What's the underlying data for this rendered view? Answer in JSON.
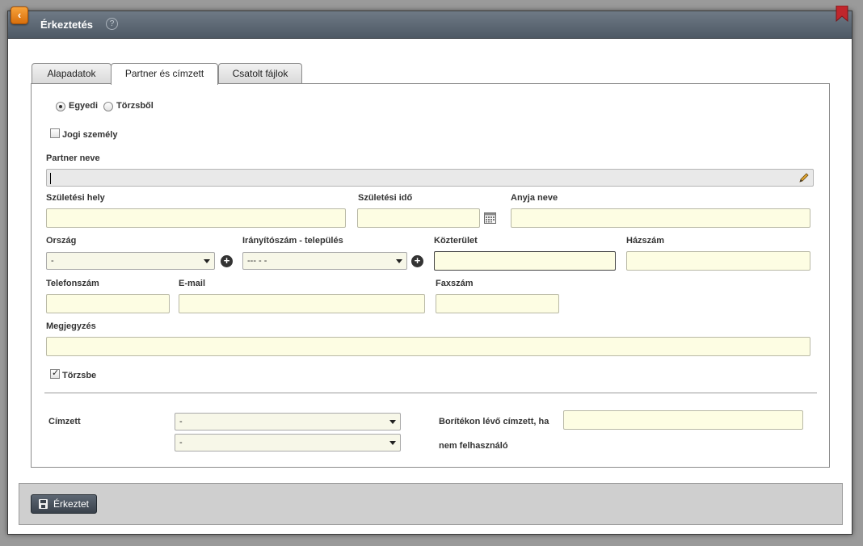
{
  "window": {
    "title": "Érkeztetés",
    "help": "?"
  },
  "tabs": [
    {
      "label": "Alapadatok",
      "active": false
    },
    {
      "label": "Partner és címzett",
      "active": true
    },
    {
      "label": "Csatolt fájlok",
      "active": false
    }
  ],
  "source": {
    "option1": "Egyedi",
    "option2": "Törzsből",
    "selected": "Egyedi"
  },
  "legal_entity": {
    "label": "Jogi személy",
    "checked": false
  },
  "partner": {
    "name_label": "Partner neve",
    "name_value": ""
  },
  "birth_place": {
    "label": "Születési hely",
    "value": ""
  },
  "birth_date": {
    "label": "Születési idő",
    "value": ""
  },
  "mother_name": {
    "label": "Anyja neve",
    "value": ""
  },
  "country": {
    "label": "Ország",
    "value": "-"
  },
  "zip_city": {
    "label": "Irányítószám - település",
    "value": "--- - -"
  },
  "street": {
    "label": "Közterület",
    "value": ""
  },
  "house_number": {
    "label": "Házszám",
    "value": ""
  },
  "phone": {
    "label": "Telefonszám",
    "value": ""
  },
  "email": {
    "label": "E-mail",
    "value": ""
  },
  "fax": {
    "label": "Faxszám",
    "value": ""
  },
  "note": {
    "label": "Megjegyzés",
    "value": ""
  },
  "save_to_registry": {
    "label": "Törzsbe",
    "checked": true
  },
  "recipient": {
    "label": "Címzett",
    "select1": "-",
    "select2": "-"
  },
  "envelope_recipient": {
    "label_line1": "Borítékon lévő címzett, ha",
    "label_line2": "nem felhasználó",
    "value": ""
  },
  "footer": {
    "submit_label": "Érkeztet"
  },
  "colors": {
    "field_bg": "#fdfde3",
    "titlebar": "#56616d",
    "accent": "#e8851f",
    "bookmark": "#c0262c"
  }
}
